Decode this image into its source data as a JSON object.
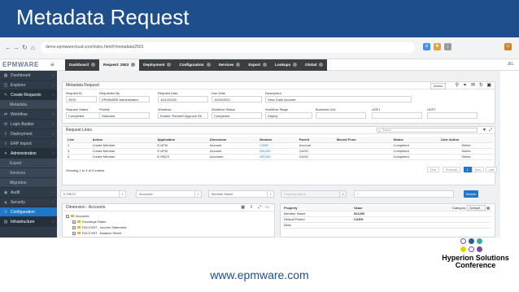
{
  "slide_title": "Metadata Request",
  "footer_url": "www.epmware.com",
  "conference": {
    "line1": "Hyperion Solutions",
    "line2": "Conference"
  },
  "browser": {
    "url": "demo.epmwarecloud.com/index.html#!/metadata/2503"
  },
  "app": {
    "logo_a": "EPM",
    "logo_b": "WARE",
    "user": "JEL",
    "tabs": [
      "Dashboard",
      "Request: 2503",
      "Deployment",
      "Configuration",
      "Services",
      "Export",
      "Lookups",
      "Global"
    ],
    "active_tab": 1
  },
  "sidebar": [
    {
      "label": "Dashboard",
      "icon": "dashboard-icon",
      "glyph": "▦",
      "type": "main"
    },
    {
      "label": "Explorer",
      "icon": "explorer-icon",
      "glyph": "◫",
      "type": "main"
    },
    {
      "label": "Create Requests",
      "icon": "create-requests-icon",
      "glyph": "✎",
      "type": "open"
    },
    {
      "label": "Metadata",
      "icon": "",
      "glyph": "",
      "type": "sub"
    },
    {
      "label": "Workflow",
      "icon": "workflow-icon",
      "glyph": "⇄",
      "type": "main"
    },
    {
      "label": "Logic Builder",
      "icon": "logic-builder-icon",
      "glyph": "⚙",
      "type": "main"
    },
    {
      "label": "Deployment",
      "icon": "deployment-icon",
      "glyph": "⇪",
      "type": "main"
    },
    {
      "label": "ERP Import",
      "icon": "erp-import-icon",
      "glyph": "⇩",
      "type": "main"
    },
    {
      "label": "Administration",
      "icon": "administration-icon",
      "glyph": "✦",
      "type": "open"
    },
    {
      "label": "Export",
      "icon": "",
      "glyph": "",
      "type": "sub"
    },
    {
      "label": "Services",
      "icon": "",
      "glyph": "",
      "type": "sub"
    },
    {
      "label": "Migration",
      "icon": "",
      "glyph": "",
      "type": "sub"
    },
    {
      "label": "Audit",
      "icon": "audit-icon",
      "glyph": "◉",
      "type": "main"
    },
    {
      "label": "Security",
      "icon": "security-icon",
      "glyph": "🔒︎",
      "type": "main"
    },
    {
      "label": "Configuration",
      "icon": "configuration-icon",
      "glyph": "⚙",
      "type": "sel"
    },
    {
      "label": "Infrastructure",
      "icon": "infrastructure-icon",
      "glyph": "▤",
      "type": "open"
    }
  ],
  "request_card": {
    "title": "Metadata Request",
    "action_label": "Action",
    "fields": [
      {
        "label": "Request ID",
        "value": "2503"
      },
      {
        "label": "Requested By",
        "value": "EPMWARE Administrator"
      },
      {
        "label": "Request Date",
        "value": "10/14/2020"
      },
      {
        "label": "Due Date",
        "value": "11/05/2020"
      },
      {
        "label": "Description",
        "value": "View Cash Account"
      },
      {
        "label": "Request Status",
        "value": "Completed"
      },
      {
        "label": "Priority",
        "value": "Standard"
      },
      {
        "label": "Workflow",
        "value": "Enable: Review+Approve De"
      },
      {
        "label": "Workflow Status",
        "value": "Completed"
      },
      {
        "label": "Workflow Stage",
        "value": "Deploy"
      },
      {
        "label": "Business Unit",
        "value": ""
      },
      {
        "label": "UDF1",
        "value": ""
      },
      {
        "label": "UDF2",
        "value": ""
      }
    ]
  },
  "lines": {
    "title": "Request Lines",
    "search_placeholder": "Search",
    "headers": [
      "Line",
      "Action",
      "Application",
      "Dimension",
      "Member",
      "Parent",
      "Moved From",
      "Status",
      "User Action"
    ],
    "rows": [
      [
        "1",
        "Create Member",
        "E-HFM",
        "Account",
        "CASH",
        "Account",
        "",
        "Completed",
        "Select"
      ],
      [
        "3",
        "Create Member",
        "E-HFM",
        "Account",
        "001200",
        "CASH",
        "",
        "Completed",
        "Select"
      ],
      [
        "4",
        "Create Member",
        "E-PBCS",
        "Accounts",
        "001200",
        "CASH",
        "",
        "Completed",
        "Select"
      ]
    ],
    "summary": "Showing 1 to 3 of 3 entries",
    "pager": [
      "First",
      "Previous",
      "1",
      "Next",
      "Last"
    ]
  },
  "filters": {
    "app": "E-PBCS",
    "dim": "Accounts",
    "member": "Member Name",
    "prop": "Property Name",
    "val": "*",
    "search_label": "Search"
  },
  "dimension": {
    "title": "Dimension - Accounts",
    "nodes": [
      "Accounts",
      "Exchange Rates",
      "FACCVBT - Income Statement",
      "FACCVBT - Balance Sheet"
    ]
  },
  "properties": {
    "headers": [
      "Property",
      "Value"
    ],
    "category_label": "Category",
    "category_value": "Default",
    "rows": [
      [
        "Member Name",
        "001200"
      ],
      [
        "Default Parent",
        "CASH"
      ],
      [
        "Alias",
        ""
      ]
    ]
  }
}
